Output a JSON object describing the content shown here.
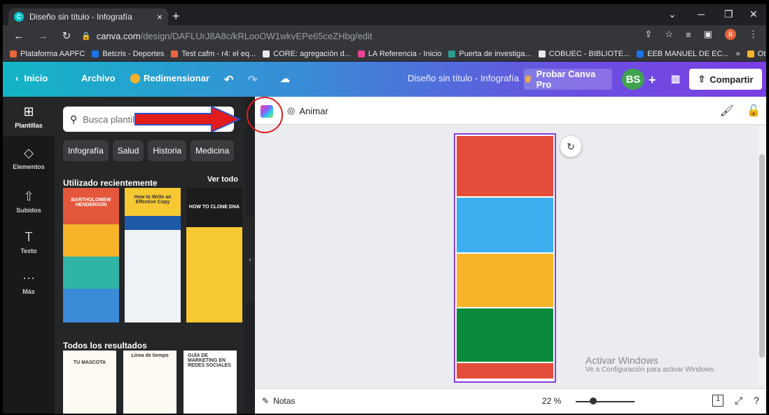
{
  "browser": {
    "tab_title": "Diseño sin título - Infografía",
    "tab_close": "×",
    "new_tab": "+",
    "url_domain": "canva.com",
    "url_path": "/design/DAFLUrJ8A8c/kRLooOW1wkvEPe65ceZHbg/edit",
    "profile_initial": "B",
    "bookmarks": [
      {
        "label": "Plataforma AAPFC",
        "color": "#e8663b"
      },
      {
        "label": "Betcris - Deportes",
        "color": "#1a73e8"
      },
      {
        "label": "Test cafm - r4: el eq...",
        "color": "#e8663b"
      },
      {
        "label": "CORE: agregación d...",
        "color": "#e8eaed"
      },
      {
        "label": "LA Referencia - Inicio",
        "color": "#e84393"
      },
      {
        "label": "Puerta de investiga...",
        "color": "#2a9d8f"
      },
      {
        "label": "COBUEC - BIBLIOTE...",
        "color": "#e8eaed"
      },
      {
        "label": "EEB MANUEL DE EC...",
        "color": "#1a73e8"
      }
    ],
    "more": "»",
    "other_bookmarks": "Otros marcadores"
  },
  "header": {
    "home": "Inicio",
    "file": "Archivo",
    "resize": "Redimensionar",
    "doc_title": "Diseño sin título - Infografía",
    "try_pro": "Probar Canva Pro",
    "avatar": "BS",
    "share": "Compartir"
  },
  "rail": [
    {
      "label": "Plantillas",
      "icon": "template-icon"
    },
    {
      "label": "Elementos",
      "icon": "elements-icon"
    },
    {
      "label": "Subidos",
      "icon": "upload-icon"
    },
    {
      "label": "Texto",
      "icon": "text-icon"
    },
    {
      "label": "Más",
      "icon": "more-icon"
    }
  ],
  "panel": {
    "search_placeholder": "Busca plantillas de infografía",
    "chips": [
      "Infografía",
      "Salud",
      "Historia",
      "Medicina"
    ],
    "recent_title": "Utilizado recientemente",
    "see_all": "Ver todo",
    "templates": [
      {
        "title": "BARTHOLOMEW HENDERSON"
      },
      {
        "title": "How to Write an Effective Copy"
      },
      {
        "title": "HOW TO CLONE DNA"
      }
    ],
    "all_results": "Todos los resultados",
    "results": [
      {
        "title": "TU MASCOTA"
      },
      {
        "title": "Línea de tiempo"
      },
      {
        "title": "GUÍA DE MARKETING EN REDES SOCIALES"
      }
    ]
  },
  "toolbar": {
    "animate": "Animar"
  },
  "canvas": {
    "blocks": [
      "#e44d3a",
      "#3daff0",
      "#f6b428",
      "#0a8a3c",
      "#e44d3a"
    ]
  },
  "bottom": {
    "notes": "Notas",
    "zoom": "22 %",
    "zoom_fraction": 0.3,
    "page_count": "1"
  },
  "watermark": {
    "title": "Activar Windows",
    "subtitle": "Ve a Configuración para activar Windows."
  }
}
